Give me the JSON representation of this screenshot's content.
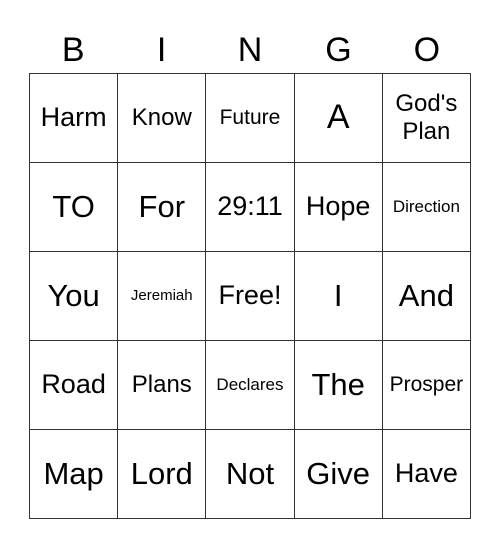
{
  "header": [
    "B",
    "I",
    "N",
    "G",
    "O"
  ],
  "rows": [
    [
      {
        "text": "Harm",
        "size": "m"
      },
      {
        "text": "Know",
        "size": "n"
      },
      {
        "text": "Future",
        "size": "s"
      },
      {
        "text": "A",
        "size": "xl"
      },
      {
        "text": "God's Plan",
        "size": "n"
      }
    ],
    [
      {
        "text": "TO",
        "size": "l"
      },
      {
        "text": "For",
        "size": "l"
      },
      {
        "text": "29:11",
        "size": "m"
      },
      {
        "text": "Hope",
        "size": "m"
      },
      {
        "text": "Direction",
        "size": "xs"
      }
    ],
    [
      {
        "text": "You",
        "size": "l"
      },
      {
        "text": "Jeremiah",
        "size": "xxs"
      },
      {
        "text": "Free!",
        "size": "m"
      },
      {
        "text": "I",
        "size": "l"
      },
      {
        "text": "And",
        "size": "l"
      }
    ],
    [
      {
        "text": "Road",
        "size": "m"
      },
      {
        "text": "Plans",
        "size": "n"
      },
      {
        "text": "Declares",
        "size": "xs"
      },
      {
        "text": "The",
        "size": "l"
      },
      {
        "text": "Prosper",
        "size": "s"
      }
    ],
    [
      {
        "text": "Map",
        "size": "l"
      },
      {
        "text": "Lord",
        "size": "l"
      },
      {
        "text": "Not",
        "size": "l"
      },
      {
        "text": "Give",
        "size": "l"
      },
      {
        "text": "Have",
        "size": "m"
      }
    ]
  ]
}
